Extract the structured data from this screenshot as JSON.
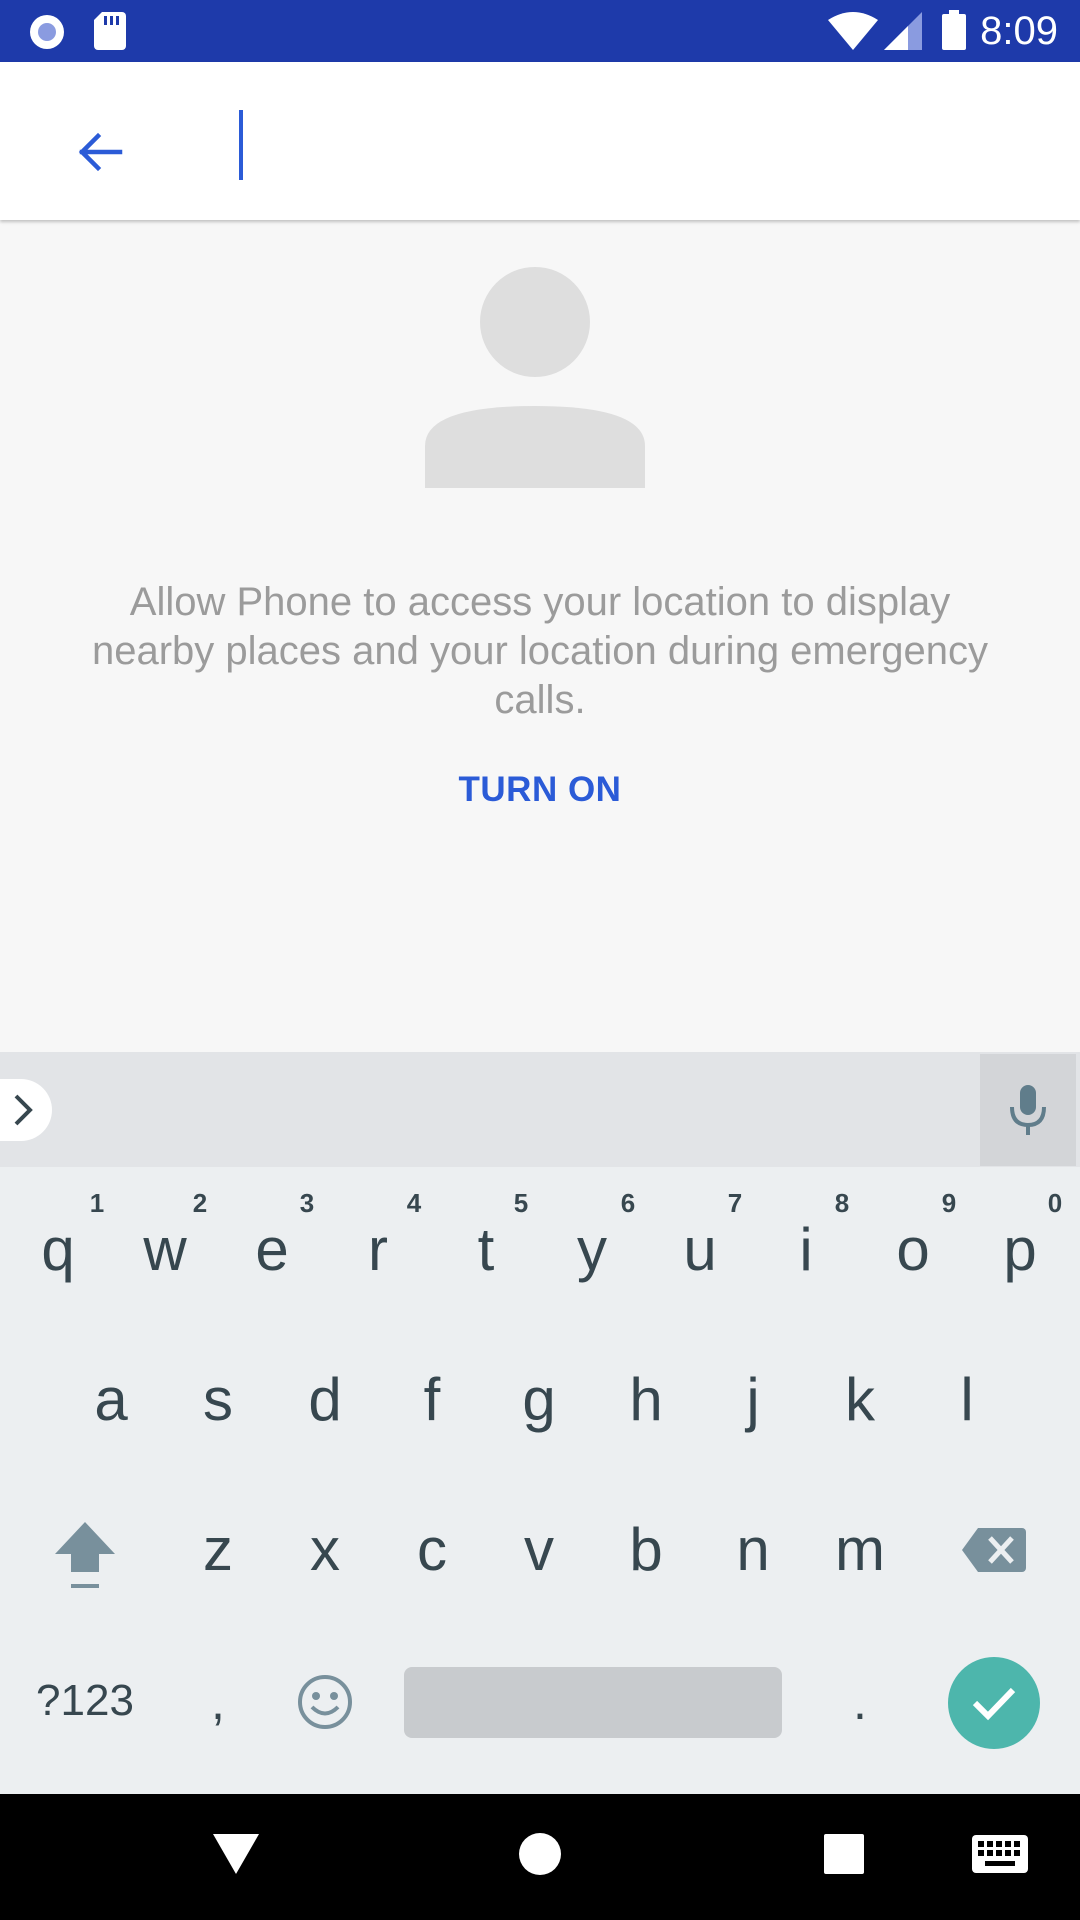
{
  "status_bar": {
    "time": "8:09",
    "icons": [
      "app-notification-icon",
      "sd-card-icon",
      "wifi-icon",
      "cell-signal-icon",
      "battery-icon"
    ],
    "background": "#1e3aaa"
  },
  "app_bar": {
    "back_icon": "arrow-left-icon",
    "search_value": "",
    "search_placeholder": ""
  },
  "location_prompt": {
    "message": "Allow Phone to access your location to display nearby places and your location during emergency calls.",
    "button_label": "TURN ON",
    "accent": "#2b5bd7"
  },
  "keyboard": {
    "row1": [
      "q",
      "w",
      "e",
      "r",
      "t",
      "y",
      "u",
      "i",
      "o",
      "p"
    ],
    "row1_hints": [
      "1",
      "2",
      "3",
      "4",
      "5",
      "6",
      "7",
      "8",
      "9",
      "0"
    ],
    "row2": [
      "a",
      "s",
      "d",
      "f",
      "g",
      "h",
      "j",
      "k",
      "l"
    ],
    "row3": [
      "z",
      "x",
      "c",
      "v",
      "b",
      "n",
      "m"
    ],
    "symbols_label": "?123",
    "comma": ",",
    "period": ".",
    "enter_color": "#4db6ac"
  },
  "nav_bar": {
    "buttons": [
      "back-triangle-icon",
      "home-circle-icon",
      "recents-square-icon",
      "keyboard-switch-icon"
    ]
  }
}
